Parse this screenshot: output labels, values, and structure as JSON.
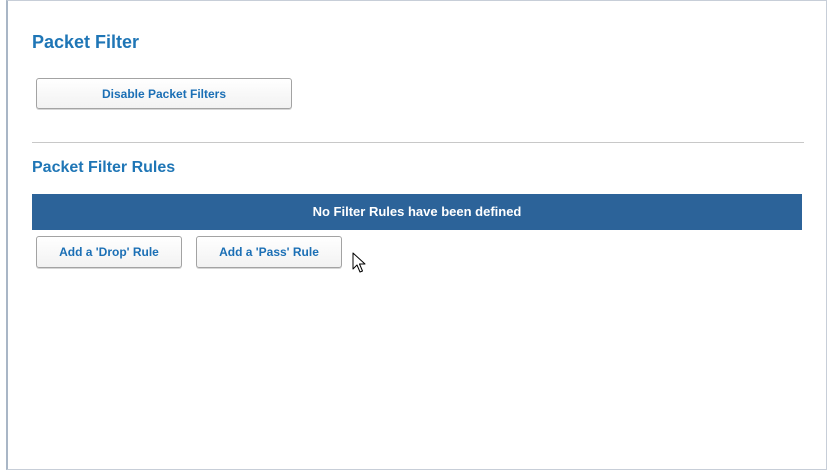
{
  "page": {
    "title": "Packet Filter",
    "disable_button_label": "Disable Packet Filters"
  },
  "rules": {
    "section_title": "Packet Filter Rules",
    "empty_message": "No Filter Rules have been defined",
    "add_drop_label": "Add a 'Drop' Rule",
    "add_pass_label": "Add a 'Pass' Rule"
  },
  "icons": {
    "cursor": "mouse-pointer-icon"
  },
  "colors": {
    "heading": "#1f76b6",
    "banner": "#2c6399",
    "button_text": "#1b6fb5"
  }
}
